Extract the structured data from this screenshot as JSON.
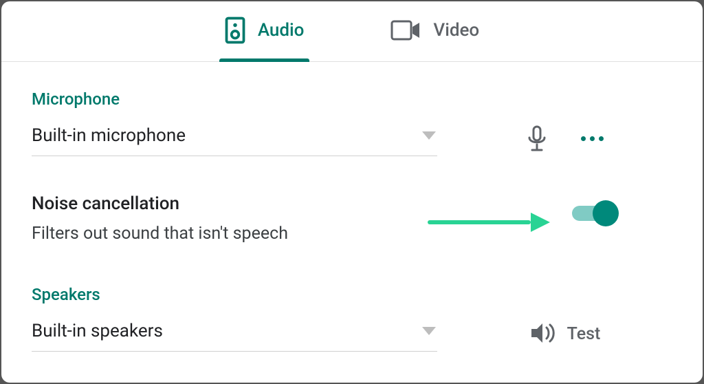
{
  "tabs": {
    "audio": "Audio",
    "video": "Video",
    "active": "audio"
  },
  "microphone": {
    "header": "Microphone",
    "selected": "Built-in microphone"
  },
  "noise_cancellation": {
    "title": "Noise cancellation",
    "description": "Filters out sound that isn't speech",
    "enabled": true
  },
  "speakers": {
    "header": "Speakers",
    "selected": "Built-in speakers",
    "test_label": "Test"
  },
  "colors": {
    "accent": "#00796b",
    "toggle_track": "#80cbc4",
    "toggle_knob": "#00897b",
    "arrow": "#29d394"
  }
}
